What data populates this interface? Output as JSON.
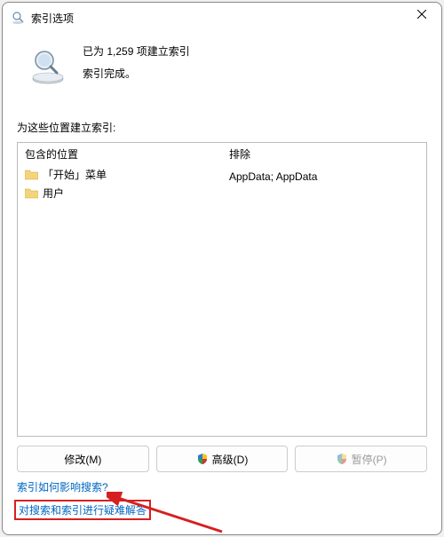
{
  "titlebar": {
    "title": "索引选项"
  },
  "status": {
    "line1": "已为 1,259 项建立索引",
    "line2": "索引完成。"
  },
  "locations": {
    "section_label": "为这些位置建立索引:",
    "included_header": "包含的位置",
    "excluded_header": "排除",
    "items": [
      {
        "name": "「开始」菜单",
        "excluded": ""
      },
      {
        "name": "用户",
        "excluded": "AppData; AppData"
      }
    ]
  },
  "buttons": {
    "modify": "修改(M)",
    "advanced": "高级(D)",
    "pause": "暂停(P)"
  },
  "links": {
    "help": "索引如何影响搜索?",
    "troubleshoot": "对搜索和索引进行疑难解答"
  }
}
